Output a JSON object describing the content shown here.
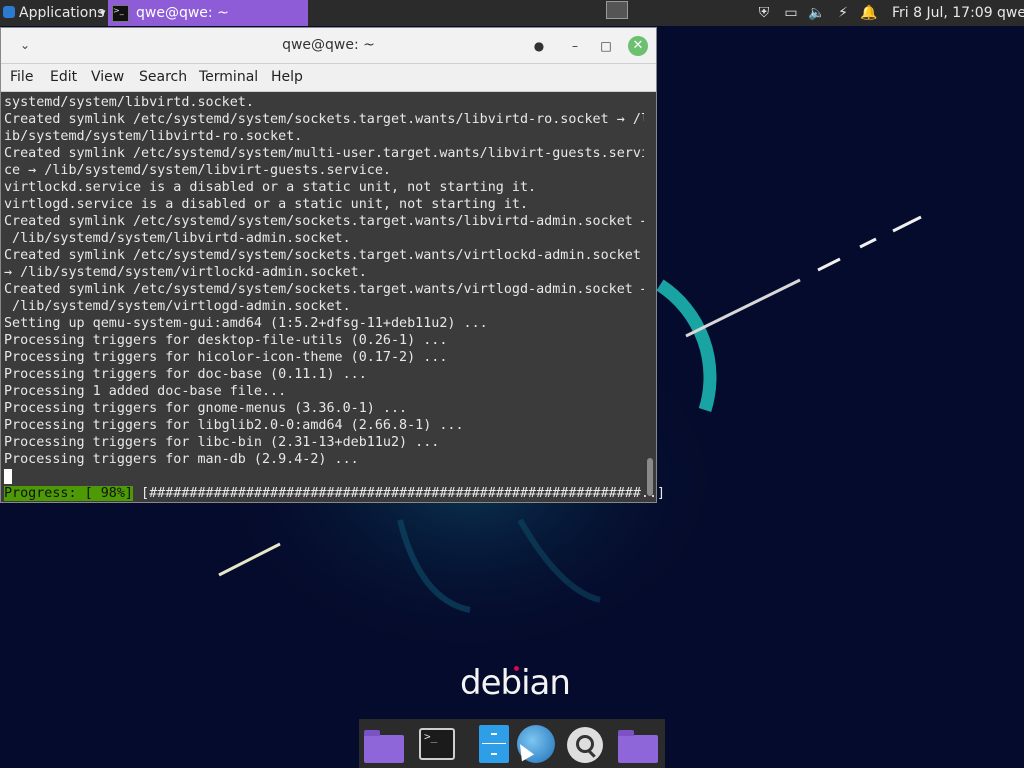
{
  "top_panel": {
    "applications_label": "Applications",
    "task_title": "qwe@qwe: ~",
    "clock": "Fri  8 Jul, 17:09",
    "user": "qwe"
  },
  "terminal": {
    "title": "qwe@qwe: ~",
    "menu": [
      "File",
      "Edit",
      "View",
      "Search",
      "Terminal",
      "Help"
    ],
    "lines": [
      "systemd/system/libvirtd.socket.",
      "Created symlink /etc/systemd/system/sockets.target.wants/libvirtd-ro.socket → /l",
      "ib/systemd/system/libvirtd-ro.socket.",
      "Created symlink /etc/systemd/system/multi-user.target.wants/libvirt-guests.servi",
      "ce → /lib/systemd/system/libvirt-guests.service.",
      "virtlockd.service is a disabled or a static unit, not starting it.",
      "virtlogd.service is a disabled or a static unit, not starting it.",
      "Created symlink /etc/systemd/system/sockets.target.wants/libvirtd-admin.socket →",
      " /lib/systemd/system/libvirtd-admin.socket.",
      "Created symlink /etc/systemd/system/sockets.target.wants/virtlockd-admin.socket",
      "→ /lib/systemd/system/virtlockd-admin.socket.",
      "Created symlink /etc/systemd/system/sockets.target.wants/virtlogd-admin.socket →",
      " /lib/systemd/system/virtlogd-admin.socket.",
      "Setting up qemu-system-gui:amd64 (1:5.2+dfsg-11+deb11u2) ...",
      "Processing triggers for desktop-file-utils (0.26-1) ...",
      "Processing triggers for hicolor-icon-theme (0.17-2) ...",
      "Processing triggers for doc-base (0.11.1) ...",
      "Processing 1 added doc-base file...",
      "Processing triggers for gnome-menus (3.36.0-1) ...",
      "Processing triggers for libglib2.0-0:amd64 (2.66.8-1) ...",
      "Processing triggers for libc-bin (2.31-13+deb11u2) ...",
      "Processing triggers for man-db (2.9.4-2) ..."
    ],
    "progress_label": "Progress: [ 98%]",
    "progress_bar": " [#############################################################..]",
    "progress_percent": 98
  },
  "desktop": {
    "logo_text": "debian"
  },
  "dock": {
    "items": [
      "folder-icon",
      "terminal-icon",
      "file-manager-icon",
      "web-browser-icon",
      "search-icon",
      "folder-icon"
    ]
  },
  "colors": {
    "panel_bg": "#2b2b2b",
    "task_active": "#8e5cd6",
    "terminal_bg": "#3b3b3b",
    "progress_green": "#4e9a06",
    "desktop_bg": "#050b2c"
  }
}
